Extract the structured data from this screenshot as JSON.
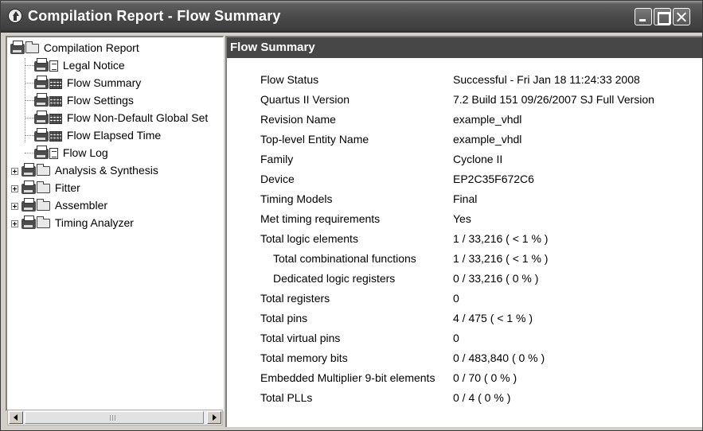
{
  "window": {
    "title": "Compilation Report - Flow Summary"
  },
  "tree": {
    "root": {
      "label": "Compilation Report",
      "icon": "printer-folder-icon"
    },
    "items": [
      {
        "label": "Legal Notice",
        "icon": "document-icon"
      },
      {
        "label": "Flow Summary",
        "icon": "table-icon"
      },
      {
        "label": "Flow Settings",
        "icon": "table-icon"
      },
      {
        "label": "Flow Non-Default Global Set",
        "icon": "table-icon"
      },
      {
        "label": "Flow Elapsed Time",
        "icon": "table-icon"
      },
      {
        "label": "Flow Log",
        "icon": "document-icon"
      }
    ],
    "folders": [
      {
        "label": "Analysis & Synthesis",
        "icon": "folder-icon"
      },
      {
        "label": "Fitter",
        "icon": "folder-icon"
      },
      {
        "label": "Assembler",
        "icon": "folder-icon"
      },
      {
        "label": "Timing Analyzer",
        "icon": "folder-icon"
      }
    ]
  },
  "report": {
    "header": "Flow Summary",
    "rows": [
      {
        "label": "Flow Status",
        "value": "Successful - Fri Jan 18 11:24:33 2008"
      },
      {
        "label": "Quartus II Version",
        "value": "7.2 Build 151 09/26/2007 SJ Full Version"
      },
      {
        "label": "Revision Name",
        "value": "example_vhdl"
      },
      {
        "label": "Top-level Entity Name",
        "value": "example_vhdl"
      },
      {
        "label": "Family",
        "value": "Cyclone II"
      },
      {
        "label": "Device",
        "value": "EP2C35F672C6"
      },
      {
        "label": "Timing Models",
        "value": "Final"
      },
      {
        "label": "Met timing requirements",
        "value": "Yes"
      },
      {
        "label": "Total logic elements",
        "value": "1 / 33,216 ( < 1 % )"
      },
      {
        "label": "Total combinational functions",
        "value": "1 / 33,216 ( < 1 % )"
      },
      {
        "label": "Dedicated logic registers",
        "value": "0 / 33,216 ( 0 % )"
      },
      {
        "label": "Total registers",
        "value": "0"
      },
      {
        "label": "Total pins",
        "value": "4 / 475 ( < 1 % )"
      },
      {
        "label": "Total virtual pins",
        "value": "0"
      },
      {
        "label": "Total memory bits",
        "value": "0 / 483,840 ( 0 % )"
      },
      {
        "label": "Embedded Multiplier 9-bit elements",
        "value": "0 / 70 ( 0 % )"
      },
      {
        "label": "Total PLLs",
        "value": "0 / 4 ( 0 % )"
      }
    ]
  },
  "scrollbar": {
    "left_icon": "chevron-left-icon",
    "right_icon": "chevron-right-icon"
  }
}
